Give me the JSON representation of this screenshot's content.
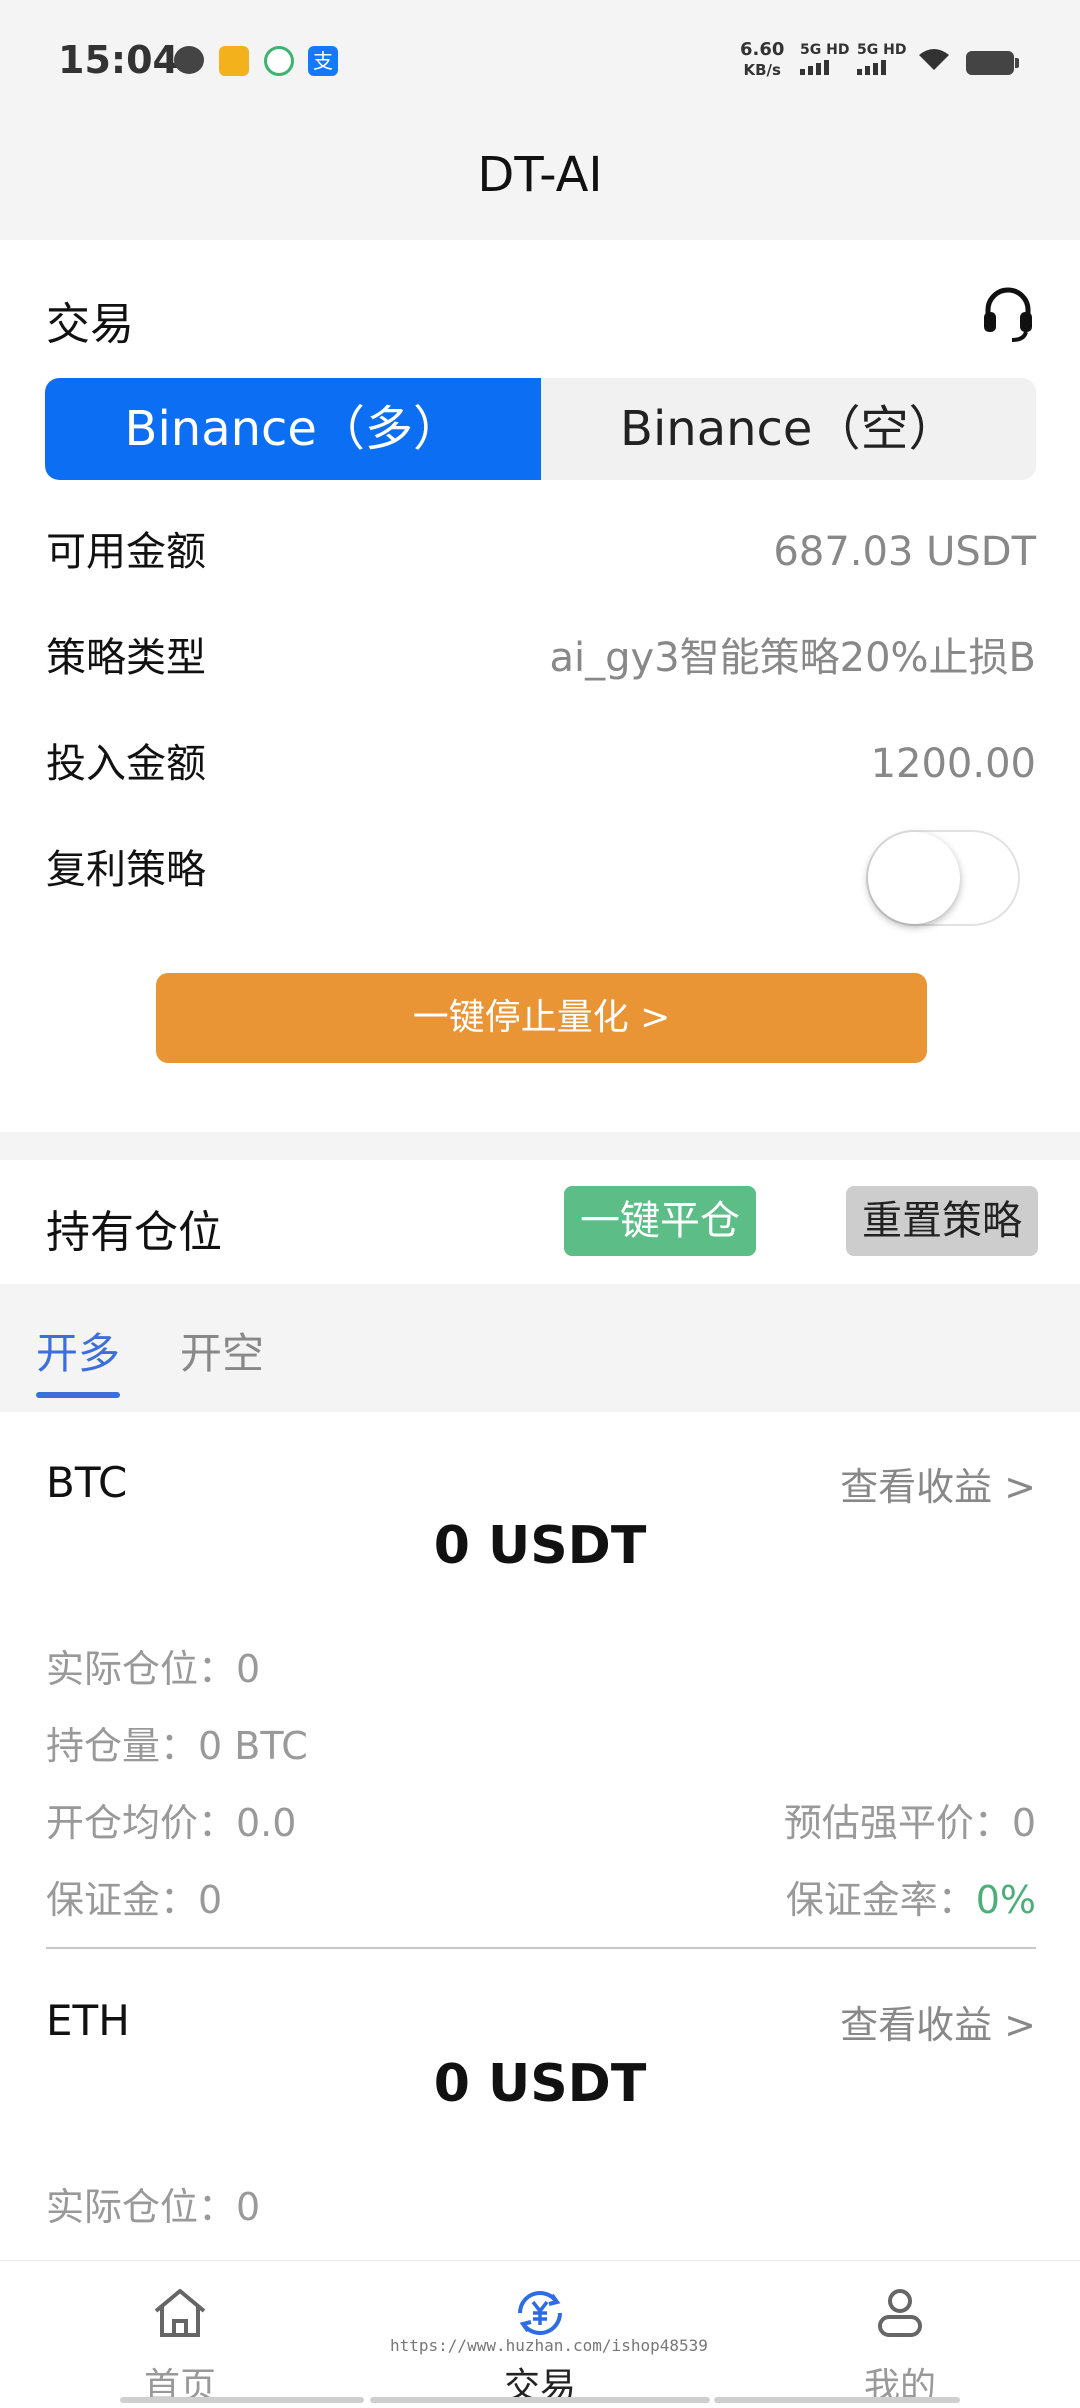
{
  "status_bar": {
    "time": "15:04",
    "speed_value": "6.60",
    "speed_unit": "KB/s",
    "signal1": "5G HD",
    "signal2": "5G HD",
    "pay_icon_text": "支"
  },
  "header": {
    "title": "DT-AI"
  },
  "trade": {
    "title": "交易",
    "tabs": [
      {
        "label": "Binance（多）",
        "active": true
      },
      {
        "label": "Binance（空）",
        "active": false
      }
    ],
    "rows": [
      {
        "label": "可用金额",
        "value": "687.03 USDT"
      },
      {
        "label": "策略类型",
        "value": "ai_gy3智能策略20%止损B"
      },
      {
        "label": "投入金额",
        "value": "1200.00"
      }
    ],
    "compound_label": "复利策略",
    "compound_on": false,
    "stop_button": "一键停止量化 >"
  },
  "positions": {
    "title": "持有仓位",
    "close_all_button": "一键平仓",
    "reset_button": "重置策略",
    "tabs": [
      {
        "label": "开多",
        "active": true
      },
      {
        "label": "开空",
        "active": false
      }
    ],
    "items": [
      {
        "coin": "BTC",
        "view_profit": "查看收益 >",
        "amount": "0 USDT",
        "actual_position": "实际仓位：0",
        "holding": "持仓量：0 BTC",
        "avg_price": "开仓均价：0.0",
        "liq_price": "预估强平价：0",
        "margin": "保证金：0",
        "margin_rate_label": "保证金率：",
        "margin_rate_value": "0%"
      },
      {
        "coin": "ETH",
        "view_profit": "查看收益 >",
        "amount": "0 USDT",
        "actual_position": "实际仓位：0"
      }
    ]
  },
  "bottom_nav": {
    "items": [
      {
        "label": "首页",
        "icon": "home-icon"
      },
      {
        "label": "交易",
        "icon": "yuan-exchange-icon",
        "active": true
      },
      {
        "label": "我的",
        "icon": "user-icon"
      }
    ]
  },
  "watermark": "https://www.huzhan.com/ishop48539",
  "colors": {
    "primary_blue": "#0b6ef3",
    "orange": "#e99535",
    "green": "#5cbd87",
    "tab_blue": "#3d6fdc"
  }
}
